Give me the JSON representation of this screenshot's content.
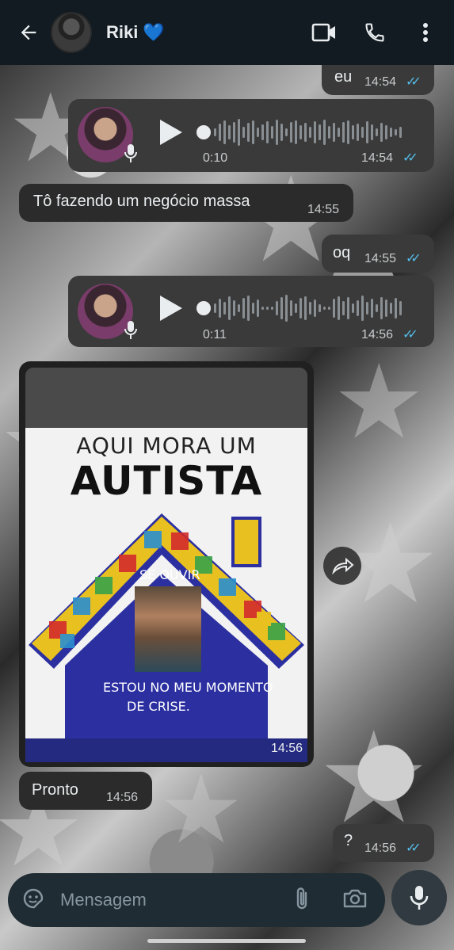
{
  "header": {
    "contact_name": "Riki",
    "contact_emoji": "💙",
    "icons": [
      "back-arrow-icon",
      "video-call-icon",
      "phone-icon",
      "more-options-icon"
    ]
  },
  "messages": [
    {
      "type": "text",
      "direction": "outgoing",
      "text": "eu",
      "time": "14:54",
      "status": "read"
    },
    {
      "type": "voice",
      "direction": "outgoing",
      "duration": "0:10",
      "time": "14:54",
      "status": "read"
    },
    {
      "type": "text",
      "direction": "incoming",
      "text": "Tô fazendo um negócio massa",
      "time": "14:55"
    },
    {
      "type": "text",
      "direction": "outgoing",
      "text": "oq",
      "time": "14:55",
      "status": "read"
    },
    {
      "type": "voice",
      "direction": "outgoing",
      "duration": "0:11",
      "time": "14:56",
      "status": "read"
    },
    {
      "type": "image",
      "direction": "incoming",
      "time": "14:56",
      "image_text": {
        "line1": "AQUI MORA UM",
        "line2": "AUTISTA",
        "line3": "SE OUVIR",
        "line4": "ESTOU NO MEU MOMENTO",
        "line5": "DE CRISE."
      }
    },
    {
      "type": "text",
      "direction": "incoming",
      "text": "Pronto",
      "time": "14:56"
    },
    {
      "type": "text",
      "direction": "outgoing",
      "text": "?",
      "time": "14:56",
      "status": "read"
    }
  ],
  "composer": {
    "placeholder": "Mensagem",
    "icons": [
      "sticker-icon",
      "attach-icon",
      "camera-icon",
      "mic-icon"
    ]
  },
  "colors": {
    "header_bg": "#111b21",
    "read_ticks": "#53bdeb",
    "outgoing_bubble": "#3a3a3a",
    "incoming_bubble": "#2b2b2b"
  }
}
